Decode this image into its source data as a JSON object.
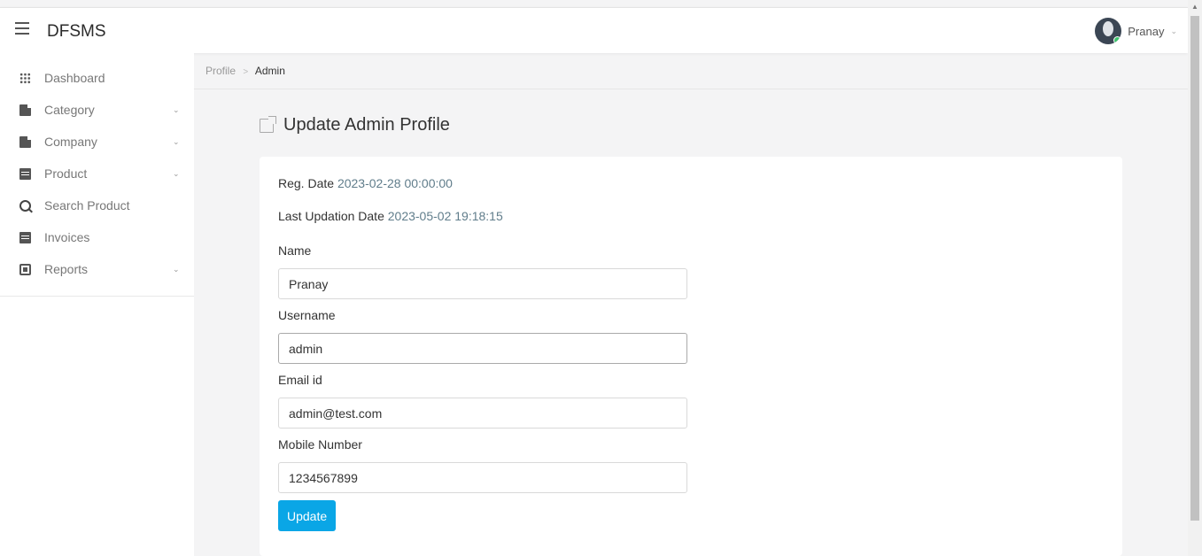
{
  "app": {
    "brand": "DFSMS"
  },
  "user": {
    "name": "Pranay"
  },
  "sidebar": {
    "items": [
      {
        "label": "Dashboard",
        "icon": "grid-icon"
      },
      {
        "label": "Category",
        "icon": "document-icon",
        "has_submenu": true
      },
      {
        "label": "Company",
        "icon": "document-icon",
        "has_submenu": true
      },
      {
        "label": "Product",
        "icon": "list-icon",
        "has_submenu": true
      },
      {
        "label": "Search Product",
        "icon": "search-icon"
      },
      {
        "label": "Invoices",
        "icon": "list-icon"
      },
      {
        "label": "Reports",
        "icon": "report-icon",
        "has_submenu": true
      }
    ]
  },
  "breadcrumb": {
    "parent": "Profile",
    "current": "Admin"
  },
  "page": {
    "title": "Update Admin Profile"
  },
  "form": {
    "reg_date_label": "Reg. Date",
    "reg_date_value": "2023-02-28 00:00:00",
    "last_update_label": "Last Updation Date",
    "last_update_value": "2023-05-02 19:18:15",
    "name_label": "Name",
    "name_value": "Pranay",
    "username_label": "Username",
    "username_value": "admin",
    "email_label": "Email id",
    "email_value": "admin@test.com",
    "mobile_label": "Mobile Number",
    "mobile_value": "1234567899",
    "submit_label": "Update"
  },
  "colors": {
    "accent": "#0aa6e6",
    "online": "#3cc36b",
    "muted_value": "#607d8b"
  }
}
